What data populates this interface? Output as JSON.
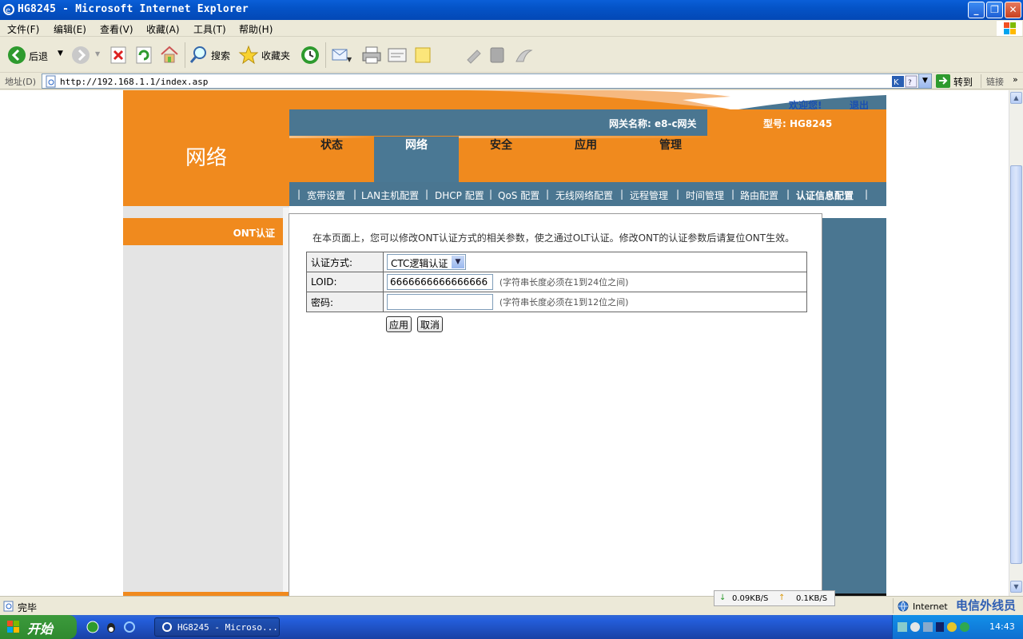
{
  "window": {
    "title": "HG8245 - Microsoft Internet Explorer",
    "min_label": "_",
    "max_label": "❐",
    "close_label": "✕"
  },
  "menu": [
    "文件(F)",
    "编辑(E)",
    "查看(V)",
    "收藏(A)",
    "工具(T)",
    "帮助(H)"
  ],
  "toolbar": {
    "back_label": "后退",
    "search_label": "搜索",
    "favorites_label": "收藏夹"
  },
  "address": {
    "label": "地址(D)",
    "url": "http://192.168.1.1/index.asp",
    "go_label": "转到",
    "links_label": "链接"
  },
  "router": {
    "welcome": "欢迎您!",
    "logout": "退出",
    "gateway_name": "网关名称: e8-c网关",
    "model": "型号: HG8245",
    "section_title": "网络",
    "tabs": [
      "状态",
      "网络",
      "安全",
      "应用",
      "管理"
    ],
    "active_tab": 1,
    "subnav": [
      "宽带设置",
      "LAN主机配置",
      "DHCP 配置",
      "QoS 配置",
      "无线网络配置",
      "远程管理",
      "时间管理",
      "路由配置",
      "认证信息配置"
    ],
    "active_subnav": 8,
    "sidebar_item": "ONT认证",
    "description": "在本页面上，您可以修改ONT认证方式的相关参数，使之通过OLT认证。修改ONT的认证参数后请复位ONT生效。",
    "form": {
      "auth_method_label": "认证方式:",
      "auth_method_value": "CTC逻辑认证",
      "loid_label": "LOID:",
      "loid_value": "6666666666666666",
      "loid_hint": "(字符串长度必须在1到24位之间)",
      "password_label": "密码:",
      "password_value": "",
      "password_hint": "(字符串长度必须在1到12位之间)",
      "apply_label": "应用",
      "cancel_label": "取消"
    }
  },
  "status": {
    "text": "完毕",
    "download": "0.09KB/S",
    "upload": "0.1KB/S",
    "zone": "Internet"
  },
  "taskbar": {
    "start_label": "开始",
    "task_label": "HG8245 - Microso...",
    "clock": "14:43",
    "watermark": "电信外线员"
  },
  "colors": {
    "orange": "#f08a1e",
    "blue_gray": "#4a7691",
    "active_tab_blue": "#4a7894"
  }
}
